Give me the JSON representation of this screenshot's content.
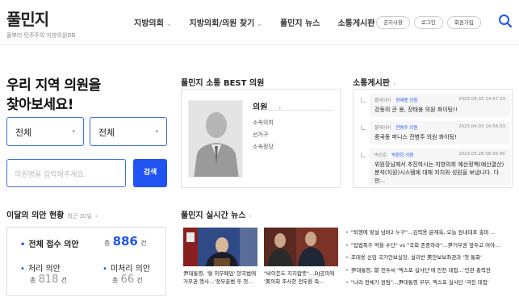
{
  "header": {
    "logo_title": "풀민지",
    "logo_subtitle": "풀뿌리 민주주의 지방의원DB",
    "nav": [
      {
        "label": "지방의회",
        "has_dropdown": true
      },
      {
        "label": "지방의회/의원 찾기",
        "has_dropdown": true
      },
      {
        "label": "풀민지 뉴스",
        "has_dropdown": false
      },
      {
        "label": "소통게시판",
        "has_dropdown": false
      }
    ],
    "util": [
      "공지사항",
      "로그인",
      "회원가입"
    ],
    "search_icon": "search-icon"
  },
  "hero": {
    "title_line1": "우리 지역 의원을",
    "title_line2": "찾아보세요!",
    "select1": "전체",
    "select2": "전체",
    "search_placeholder": "의원명을 입력해주세요.",
    "search_button": "검색"
  },
  "bills": {
    "title": "이달의 의안 현황",
    "period": "최근 30일",
    "total_label": "전체 접수 의안",
    "total_prefix": "총",
    "total_value": "886",
    "total_unit": "건",
    "processed_label": "처리 의안",
    "processed_prefix": "총",
    "processed_value": "818",
    "processed_unit": "건",
    "unprocessed_label": "미처리 의안",
    "unprocessed_prefix": "총",
    "unprocessed_value": "66",
    "unprocessed_unit": "건"
  },
  "best": {
    "title": "풀민지 소통 BEST 의원",
    "name": "의원",
    "fields": [
      "소속의회",
      "선거구",
      "소속정당"
    ]
  },
  "board": {
    "title": "소통게시판",
    "posts": [
      {
        "author": "플레이어",
        "member": "장태용 의원",
        "time": "2023.04.03 14:57:29",
        "text": "강동의 큰 용, 장태용 의원 화이팅!!"
      },
      {
        "author": "플레이어",
        "member": "전병주 의원",
        "time": "2023.04.03 14:56:03",
        "text": "중곡동 퍼니스 전병주 의원 화이팅!"
      },
      {
        "author": "박선준",
        "member": "박환희 의원",
        "time": "2023.03.28 08:35:45",
        "text": "위원장님께서 추진하시는 지방의회 예산정책(예산결산) 분석(지원)시스템에 대해 지지와 성원을 보냅니다. 다만..."
      }
    ]
  },
  "news": {
    "title": "풀민지 실시간 뉴스",
    "cards": [
      {
        "caption": "尹대통령, '혈 의무폐업' 양곡법에 거부권 행사…'정부출범 후 첫..."
      },
      {
        "caption": "\"바이든도 지지합뜻\"…DJ공의에 '美의회 조사한 전두환 측..."
      }
    ],
    "list": [
      "\"퇴행에 맞설 넘버2 누구\"…김력용·윤재옥, 오늘 원내대표 출마 ...",
      "\"입법폭주 막을 수단\" vs \"국회 존중하라\"…尹거부권 앞두고 여야...",
      "조태용 신임 국가안보실장, 설리반 美안보보좌관과 '첫 통화'",
      "尹대통령, 前 전두씨 '엑스포 실사단'에 만찬 대접…'민관 총력전",
      "\"나라 전체가 원팀\"…尹대통령 부부, 엑스포 실사단 '극진 대접'"
    ]
  },
  "colors": {
    "accent": "#1f53f2",
    "border_blue": "#3b6ee8",
    "text_dark": "#222222",
    "muted": "#999999"
  }
}
